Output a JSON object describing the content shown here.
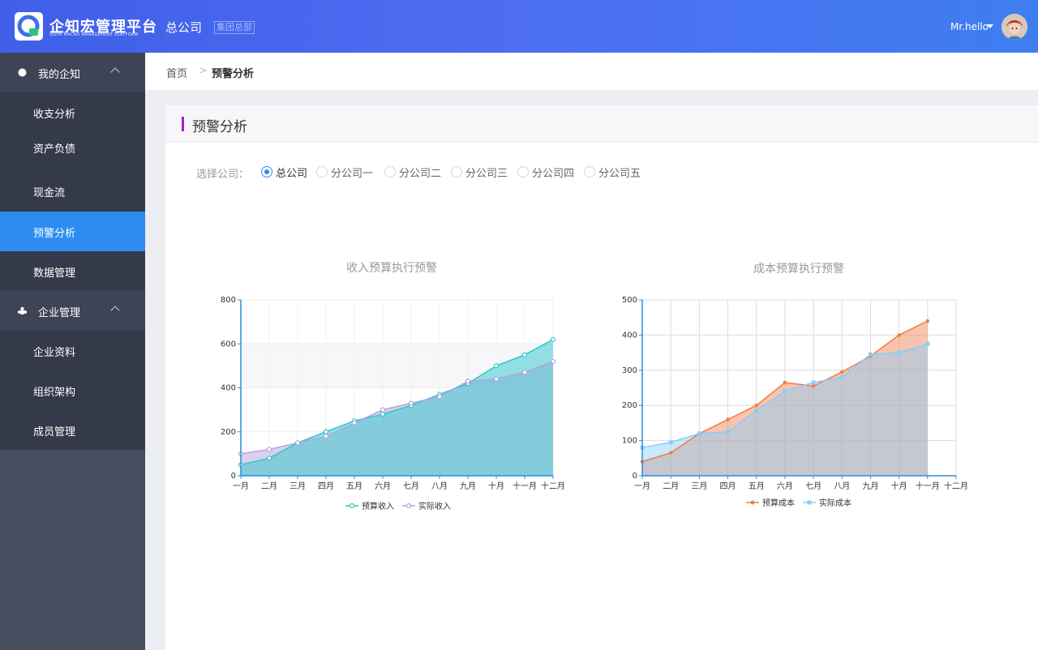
{
  "header": {
    "logo_title": "企知宏管理平台",
    "logo_subtitle": "QIZHI MACRO MANAGEMENT PLATFORM",
    "company": "总公司",
    "company_badge": "集团总部",
    "user_name": "Mr.hello",
    "colors": {
      "gradient_start": "#3f5fe8",
      "gradient_end": "#3f7ef0"
    }
  },
  "sidebar": {
    "groups": [
      {
        "label": "我的企知",
        "icon": "circle-icon",
        "expanded": true,
        "items": [
          {
            "label": "收支分析"
          },
          {
            "label": "资产负债"
          },
          {
            "label": "现金流"
          },
          {
            "label": "预警分析",
            "active": true
          },
          {
            "label": "数据管理"
          }
        ]
      },
      {
        "label": "企业管理",
        "icon": "cluster-icon",
        "expanded": true,
        "items": [
          {
            "label": "企业资料"
          },
          {
            "label": "组织架构"
          },
          {
            "label": "成员管理"
          }
        ]
      }
    ],
    "active_color": "#2d8cf0"
  },
  "breadcrumb": {
    "home": "首页",
    "separator": ">",
    "current": "预警分析"
  },
  "panel": {
    "title": "预警分析",
    "filter_label": "选择公司：",
    "options": [
      "总公司",
      "分公司一",
      "分公司二",
      "分公司三",
      "分公司四",
      "分公司五"
    ],
    "selected": "总公司"
  },
  "chart_data": [
    {
      "type": "area",
      "title": "收入预算执行预警",
      "categories": [
        "一月",
        "二月",
        "三月",
        "四月",
        "五月",
        "六月",
        "七月",
        "八月",
        "九月",
        "十月",
        "十一月",
        "十二月"
      ],
      "ylim": [
        0,
        800
      ],
      "yticks": [
        0,
        200,
        400,
        600,
        800
      ],
      "grid": true,
      "legend_position": "bottom",
      "series": [
        {
          "name": "预算收入",
          "color": "#2ec7c9",
          "values": [
            50,
            80,
            150,
            200,
            250,
            280,
            320,
            370,
            420,
            500,
            550,
            620
          ]
        },
        {
          "name": "实际收入",
          "color": "#b6a2de",
          "values": [
            100,
            120,
            150,
            180,
            240,
            300,
            330,
            360,
            430,
            440,
            470,
            520
          ]
        }
      ]
    },
    {
      "type": "area",
      "title": "成本预算执行预警",
      "categories": [
        "一月",
        "二月",
        "三月",
        "四月",
        "五月",
        "六月",
        "七月",
        "八月",
        "九月",
        "十月",
        "十一月",
        "十二月"
      ],
      "ylim": [
        0,
        500
      ],
      "yticks": [
        0,
        100,
        200,
        300,
        400,
        500
      ],
      "grid": true,
      "legend_position": "bottom",
      "series": [
        {
          "name": "预算成本",
          "color": "#f07c4a",
          "values": [
            40,
            65,
            120,
            160,
            200,
            265,
            255,
            295,
            340,
            400,
            440
          ]
        },
        {
          "name": "实际成本",
          "color": "#87cefa",
          "values": [
            80,
            95,
            120,
            125,
            185,
            240,
            265,
            280,
            345,
            350,
            375
          ]
        }
      ]
    }
  ]
}
